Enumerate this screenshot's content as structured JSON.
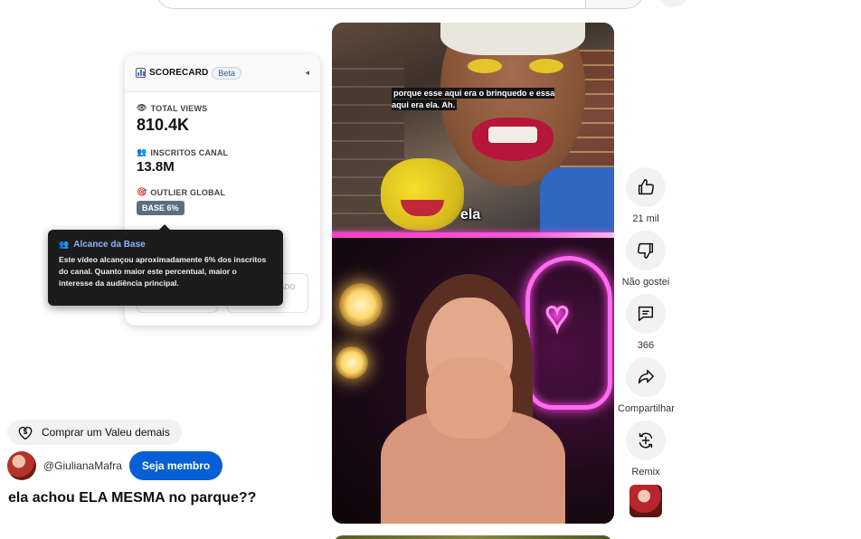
{
  "scorecard": {
    "title": "SCORECARD",
    "beta": "Beta",
    "collapse_icon": "◂",
    "metrics": {
      "total_views": {
        "label": "TOTAL VIEWS",
        "value": "810.4K",
        "icon": "👁"
      },
      "inscritos": {
        "label": "INSCRITOS CANAL",
        "value": "13.8M",
        "icon": "👥"
      },
      "outlier": {
        "label": "OUTLIER GLOBAL",
        "badge": "BASE 6%",
        "icon": "🎯"
      }
    },
    "faded_box_right": "INÍCIO ESTIMADO EST."
  },
  "tooltip": {
    "title": "Alcance da Base",
    "text": "Este vídeo alcançou aproximadamente 6% dos inscritos do canal. Quanto maior este percentual, maior o interesse da audiência principal."
  },
  "video": {
    "caption": "porque esse aqui era o brinquedo e essa aqui era ela. Ah.",
    "overlay_word": "ela"
  },
  "actions": {
    "like": "21 mil",
    "dislike": "Não gostei",
    "comments": "366",
    "share": "Compartilhar",
    "remix": "Remix"
  },
  "info": {
    "buy_label": "Comprar um Valeu demais",
    "channel": "@GiulianaMafra",
    "member_button": "Seja membro",
    "title": "ela achou ELA MESMA no parque??"
  },
  "colors": {
    "member_button": "#065fd4",
    "tooltip_title": "#8ab4ff",
    "neon": "#ff6bf1"
  }
}
